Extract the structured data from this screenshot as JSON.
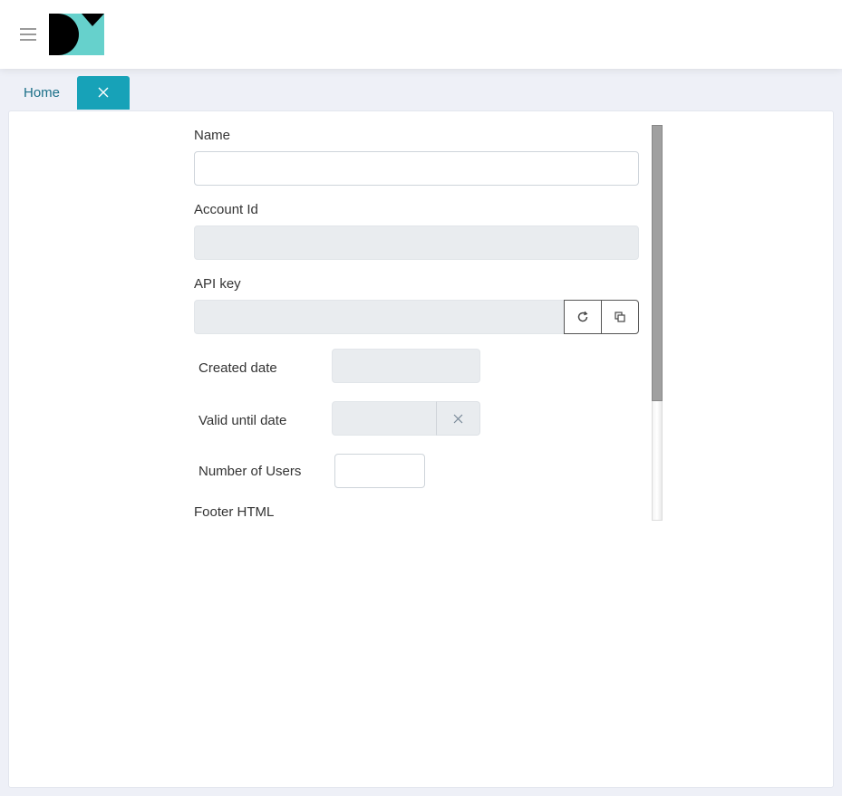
{
  "header": {
    "menu_icon": "hamburger-menu-icon",
    "logo_icon": "dm-logo",
    "colors": {
      "logo_teal": "#66d1cc",
      "logo_black": "#000000"
    }
  },
  "tabs": {
    "home_label": "Home",
    "active_close_icon": "close-icon",
    "active_color": "#17a2b8"
  },
  "form": {
    "name": {
      "label": "Name",
      "value": ""
    },
    "account_id": {
      "label": "Account Id",
      "value": ""
    },
    "api_key": {
      "label": "API key",
      "value": "",
      "refresh_icon": "refresh-icon",
      "copy_icon": "copy-icon"
    },
    "created_date": {
      "label": "Created date",
      "value": ""
    },
    "valid_until": {
      "label": "Valid until date",
      "value": "",
      "clear_icon": "clear-icon"
    },
    "number_of_users": {
      "label": "Number of Users",
      "value": ""
    },
    "footer_html": {
      "label": "Footer HTML"
    }
  }
}
